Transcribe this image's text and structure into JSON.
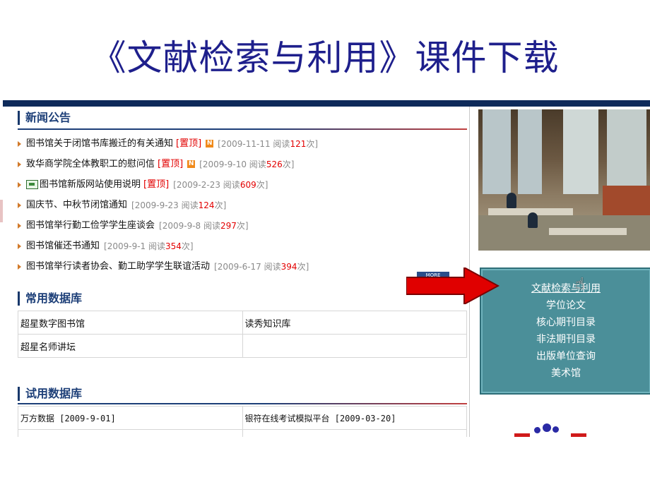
{
  "slide": {
    "title": "《文献检索与利用》课件下载"
  },
  "news": {
    "heading": "新闻公告",
    "items": [
      {
        "title": "图书馆关于闭馆书库搬迁的有关通知",
        "top": "[置顶]",
        "badge": "N",
        "date": "[2009-11-11",
        "read_label": "阅读",
        "reads": "121",
        "unit": "次]"
      },
      {
        "title": "致华商学院全体教职工的慰问信",
        "top": "[置顶]",
        "badge": "N",
        "date": "[2009-9-10",
        "read_label": "阅读",
        "reads": "526",
        "unit": "次]"
      },
      {
        "title": "图书馆新版网站使用说明",
        "top": "[置顶]",
        "date": "[2009-2-23",
        "read_label": "阅读",
        "reads": "609",
        "unit": "次]"
      },
      {
        "title": "国庆节、中秋节闭馆通知",
        "date": "[2009-9-23",
        "read_label": "阅读",
        "reads": "124",
        "unit": "次]"
      },
      {
        "title": "图书馆举行勤工俭学学生座谈会",
        "date": "[2009-9-8",
        "read_label": "阅读",
        "reads": "297",
        "unit": "次]"
      },
      {
        "title": "图书馆催还书通知",
        "date": "[2009-9-1",
        "read_label": "阅读",
        "reads": "354",
        "unit": "次]"
      },
      {
        "title": "图书馆举行读者协会、勤工助学学生联谊活动",
        "date": "[2009-6-17",
        "read_label": "阅读",
        "reads": "394",
        "unit": "次]"
      }
    ],
    "more": "MORE"
  },
  "common_db": {
    "heading": "常用数据库",
    "rows": [
      [
        "超星数字图书馆",
        "读秀知识库"
      ],
      [
        "超星名师讲坛",
        ""
      ]
    ]
  },
  "trial_db": {
    "heading": "试用数据库",
    "rows": [
      [
        "万方数据 [2009-9-01]",
        "银符在线考试模拟平台 [2009-03-20]"
      ],
      [
        "",
        ""
      ]
    ]
  },
  "sidebar": {
    "links": [
      "文献检索与利用",
      "学位论文",
      "核心期刊目录",
      "非法期刊目录",
      "出版单位查询",
      "美术馆"
    ]
  },
  "colors": {
    "title": "#1e1f8c",
    "section": "#1d3f78",
    "highlight": "#e20000",
    "link_box": "#4b8f99",
    "arrow": "#e00000"
  }
}
